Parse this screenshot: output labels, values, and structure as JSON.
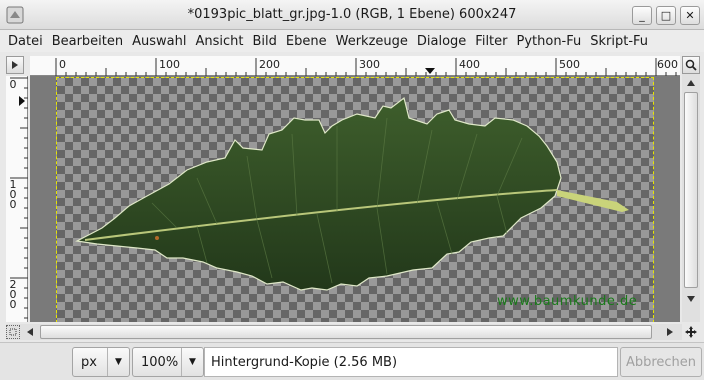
{
  "window": {
    "title": "*0193pic_blatt_gr.jpg-1.0 (RGB, 1 Ebene) 600x247",
    "buttons": {
      "minimize": "_",
      "maximize": "□",
      "close": "✕"
    }
  },
  "menubar": {
    "items": [
      {
        "label": "Datei"
      },
      {
        "label": "Bearbeiten"
      },
      {
        "label": "Auswahl"
      },
      {
        "label": "Ansicht"
      },
      {
        "label": "Bild"
      },
      {
        "label": "Ebene"
      },
      {
        "label": "Werkzeuge"
      },
      {
        "label": "Dialoge"
      },
      {
        "label": "Filter"
      },
      {
        "label": "Python-Fu"
      },
      {
        "label": "Skript-Fu"
      }
    ]
  },
  "rulers": {
    "horizontal": [
      "0",
      "100",
      "200",
      "300",
      "400",
      "500",
      "600"
    ],
    "vertical": [
      "0",
      "100",
      "200"
    ]
  },
  "canvas": {
    "watermark": "www.baumkunde.de"
  },
  "statusbar": {
    "unit": "px",
    "zoom": "100%",
    "info": "Hintergrund-Kopie (2.56 MB)",
    "cancel_label": "Abbrechen"
  },
  "colors": {
    "leaf": "#2f4a22",
    "selection_border": "#e6e600",
    "watermark": "#1a7a1a"
  }
}
